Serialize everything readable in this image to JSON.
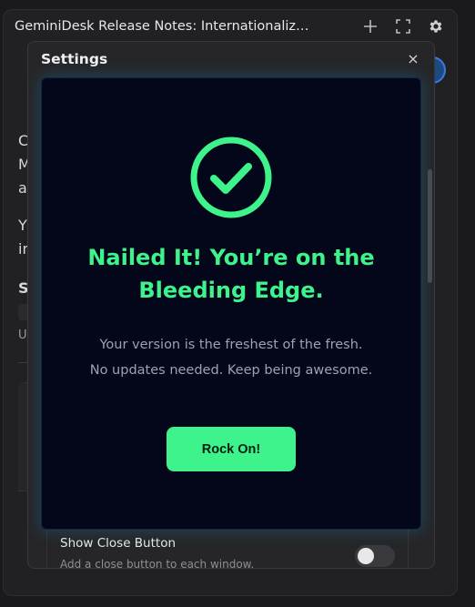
{
  "background_window": {
    "title": "GeminiDesk Release Notes: Internationalizati…",
    "peek_lines": [
      "C",
      "M",
      "a",
      "Y",
      "in",
      "S",
      "U"
    ]
  },
  "settings": {
    "title": "Settings",
    "close_glyph": "×",
    "obscured_heading": "",
    "row": {
      "label": "Show Close Button",
      "description": "Add a close button to each window."
    }
  },
  "modal": {
    "heading": "Nailed It! You’re on the Bleeding Edge.",
    "body_line1": "Your version is the freshest of the fresh.",
    "body_line2": "No updates needed. Keep being awesome.",
    "button_label": "Rock On!",
    "accent_color": "#3ef28c",
    "background_color": "#030719",
    "icon": "check-circle-icon"
  },
  "icons": {
    "add": "plus-icon",
    "fullscreen": "fullscreen-icon",
    "settings": "gear-icon",
    "close": "close-icon"
  }
}
